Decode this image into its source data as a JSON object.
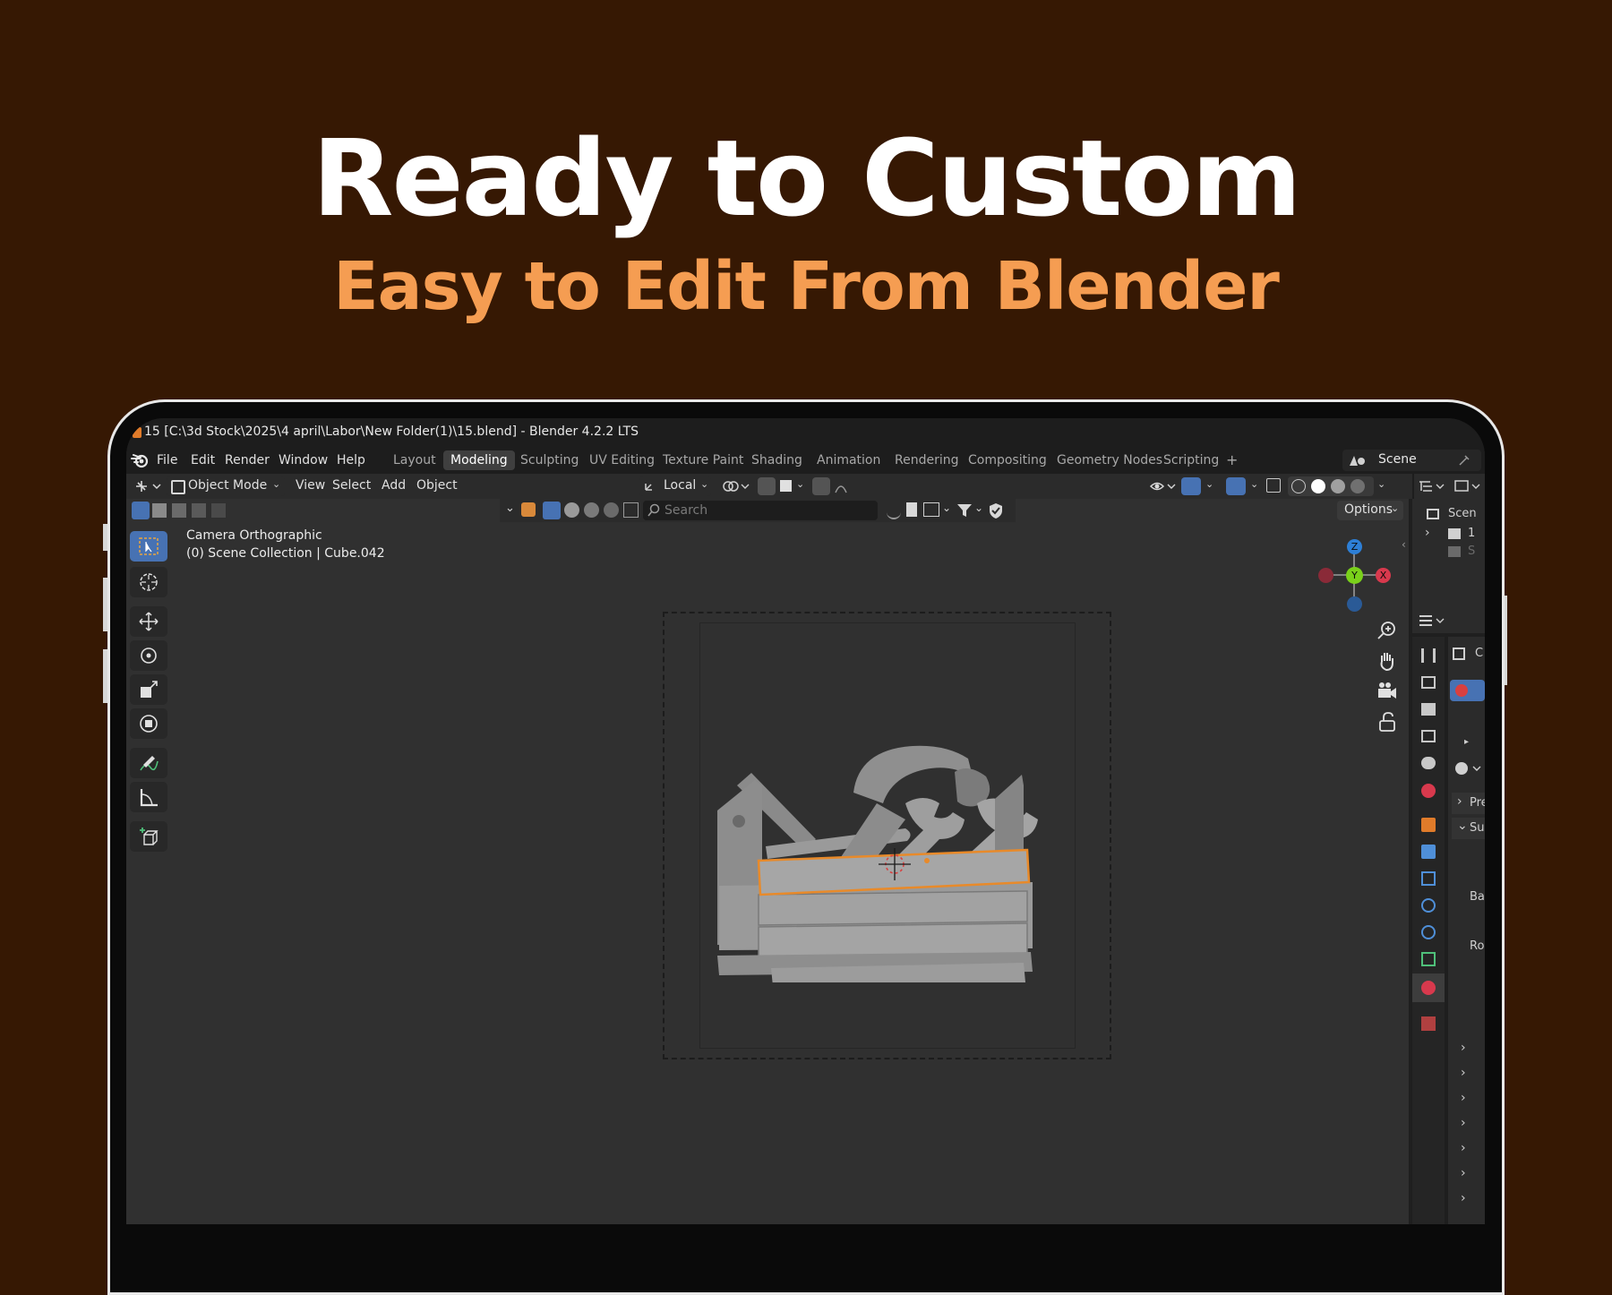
{
  "hero": {
    "title": "Ready to Custom",
    "subtitle": "Easy to Edit From Blender"
  },
  "window": {
    "title": "15 [C:\\3d Stock\\2025\\4 april\\Labor\\New Folder(1)\\15.blend] - Blender 4.2.2 LTS"
  },
  "menu": {
    "items": [
      "File",
      "Edit",
      "Render",
      "Window",
      "Help"
    ]
  },
  "workspaces": {
    "tabs": [
      "Layout",
      "Modeling",
      "Sculpting",
      "UV Editing",
      "Texture Paint",
      "Shading",
      "Animation",
      "Rendering",
      "Compositing",
      "Geometry Nodes",
      "Scripting"
    ],
    "active": "Modeling",
    "add": "+"
  },
  "scene": {
    "label": "Scene"
  },
  "header": {
    "mode": "Object Mode",
    "view": "View",
    "select": "Select",
    "add": "Add",
    "object": "Object",
    "transform_orientation": "Local",
    "options": "Options",
    "search_placeholder": "Search"
  },
  "viewport": {
    "camera_label": "Camera Orthographic",
    "collection_label": "(0) Scene Collection | Cube.042"
  },
  "gizmo": {
    "z": "Z",
    "y": "Y",
    "x": "X",
    "colors": {
      "x": "#d8394d",
      "y": "#7ad11a",
      "z": "#2d7fd6"
    }
  },
  "outliner": {
    "row1": "Scen",
    "row2": "1",
    "row3": "S"
  },
  "properties": {
    "tab_label": "C",
    "pre_label": "Pre",
    "su_label": "Su",
    "ba_label": "Ba",
    "ro_label": "Ro"
  },
  "colors": {
    "background": "#361803",
    "accent_orange": "#f59d52",
    "active_blue": "#4772b3",
    "selection_outline": "#e88a2a"
  }
}
